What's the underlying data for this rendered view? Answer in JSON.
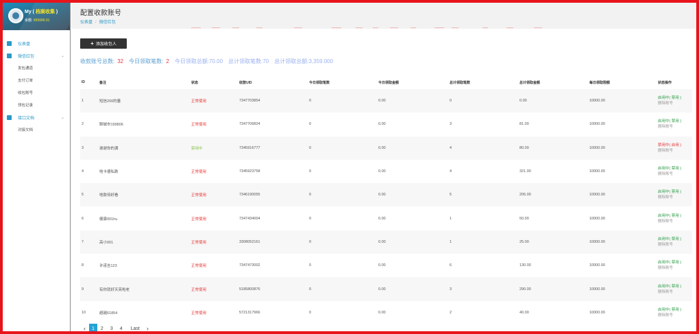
{
  "sidebar": {
    "user_prefix": "My ( ",
    "user_name": "档案收集",
    "user_suffix": " )",
    "balance_label": "余额:",
    "balance_value": "999999.91",
    "menu": [
      {
        "label": "仪表盘",
        "icon": "dashboard-icon",
        "has_chevron": false
      },
      {
        "label": "微信红包",
        "icon": "redpacket-icon",
        "has_chevron": true,
        "children": [
          "发包通道",
          "支付订单",
          "收包账号",
          "领包记录"
        ]
      },
      {
        "label": "接口文档",
        "icon": "document-icon",
        "has_chevron": true,
        "children": [
          "对接文档"
        ]
      }
    ]
  },
  "header": {
    "title": "配置收款账号",
    "breadcrumb": [
      "仪表盘",
      "微信红包"
    ]
  },
  "toolbar": {
    "add_label": "添加收包人",
    "add_icon": "+"
  },
  "stats": [
    {
      "label": "收款账号总数:",
      "value": "32",
      "faded": false
    },
    {
      "label": "今日领取笔数:",
      "value": "2",
      "faded": false
    },
    {
      "label": "今日领取总额:",
      "value": "70.00",
      "faded": true
    },
    {
      "label": "总计领取笔数:",
      "value": "70",
      "faded": true
    },
    {
      "label": "总计领取总额:",
      "value": "3,359.000",
      "faded": true
    }
  ],
  "table": {
    "columns": [
      "ID",
      "备注",
      "状态",
      "收款UID",
      "今日领取笔数",
      "今日领取金额",
      "总计领取笔数",
      "总计领取金额",
      "每日领取限额",
      "状态操作"
    ],
    "rows": [
      {
        "id": "1",
        "note": "短信200的量",
        "status": "正常使用",
        "status_type": "normal",
        "uid": "7347703854",
        "today_cnt": "0",
        "today_amt": "0.00",
        "total_cnt": "0",
        "total_amt": "0.00",
        "limit": "10000.00",
        "op_state": "启用中",
        "op_toggle": "( 禁用 )",
        "op_delete": "删除账号",
        "op_enabled": true
      },
      {
        "id": "2",
        "note": "聊城市199806",
        "status": "正常使用",
        "status_type": "normal",
        "uid": "7347706824",
        "today_cnt": "0",
        "today_amt": "0.00",
        "total_cnt": "3",
        "total_amt": "81.00",
        "limit": "10000.00",
        "op_state": "启用中",
        "op_toggle": "( 禁用 )",
        "op_delete": "删除账号",
        "op_enabled": true
      },
      {
        "id": "3",
        "note": "谢谢你的满",
        "status": "禁用中",
        "status_type": "disabled",
        "uid": "7345916777",
        "today_cnt": "0",
        "today_amt": "0.00",
        "total_cnt": "4",
        "total_amt": "80.00",
        "limit": "10000.00",
        "op_state": "禁用中",
        "op_toggle": "( 启用 )",
        "op_delete": "删除账号",
        "op_enabled": false
      },
      {
        "id": "4",
        "note": "啥卡德私跌",
        "status": "正常使用",
        "status_type": "normal",
        "uid": "7345923758",
        "today_cnt": "0",
        "today_amt": "0.00",
        "total_cnt": "4",
        "total_amt": "321.00",
        "limit": "10000.00",
        "op_state": "启用中",
        "op_toggle": "( 禁用 )",
        "op_delete": "删除账号",
        "op_enabled": true
      },
      {
        "id": "5",
        "note": "啥款待好看",
        "status": "正常使用",
        "status_type": "normal",
        "uid": "7346190055",
        "today_cnt": "0",
        "today_amt": "0.00",
        "total_cnt": "5",
        "total_amt": "205.00",
        "limit": "10000.00",
        "op_state": "启用中",
        "op_toggle": "( 禁用 )",
        "op_delete": "删除账号",
        "op_enabled": true
      },
      {
        "id": "6",
        "note": "健康001hu",
        "status": "正常使用",
        "status_type": "normal",
        "uid": "7347434004",
        "today_cnt": "0",
        "today_amt": "0.00",
        "total_cnt": "1",
        "total_amt": "50.00",
        "limit": "10000.00",
        "op_state": "启用中",
        "op_toggle": "( 禁用 )",
        "op_delete": "删除账号",
        "op_enabled": true
      },
      {
        "id": "7",
        "note": "高小001",
        "status": "正常使用",
        "status_type": "normal",
        "uid": "3308052161",
        "today_cnt": "0",
        "today_amt": "0.00",
        "total_cnt": "1",
        "total_amt": "25.00",
        "limit": "10000.00",
        "op_state": "启用中",
        "op_toggle": "( 禁用 )",
        "op_delete": "删除账号",
        "op_enabled": true
      },
      {
        "id": "8",
        "note": "许诺吉123",
        "status": "正常使用",
        "status_type": "normal",
        "uid": "7347473002",
        "today_cnt": "0",
        "today_amt": "0.00",
        "total_cnt": "6",
        "total_amt": "130.00",
        "limit": "10000.00",
        "op_state": "启用中",
        "op_toggle": "( 禁用 )",
        "op_delete": "删除账号",
        "op_enabled": true
      },
      {
        "id": "9",
        "note": "有你就好天亮啦老",
        "status": "正常使用",
        "status_type": "normal",
        "uid": "5185800876",
        "today_cnt": "0",
        "today_amt": "0.00",
        "total_cnt": "3",
        "total_amt": "290.00",
        "limit": "10000.00",
        "op_state": "启用中",
        "op_toggle": "( 禁用 )",
        "op_delete": "删除账号",
        "op_enabled": true
      },
      {
        "id": "10",
        "note": "超越61854",
        "status": "正常使用",
        "status_type": "normal",
        "uid": "5721317966",
        "today_cnt": "0",
        "today_amt": "0.00",
        "total_cnt": "2",
        "total_amt": "40.00",
        "limit": "10000.00",
        "op_state": "启用中",
        "op_toggle": "( 禁用 )",
        "op_delete": "删除账号",
        "op_enabled": true
      }
    ]
  },
  "pagination": {
    "prev": "‹",
    "pages": [
      "1",
      "2",
      "3",
      "4"
    ],
    "current": "1",
    "last": "Last",
    "next": "›"
  },
  "colors": {
    "frame": "#e8141c",
    "accent": "#2a98c6",
    "status_normal": "#e43a3a",
    "status_disabled": "#8bc34a",
    "op_enabled": "#2e9d48",
    "page_active": "#24a3d4"
  }
}
